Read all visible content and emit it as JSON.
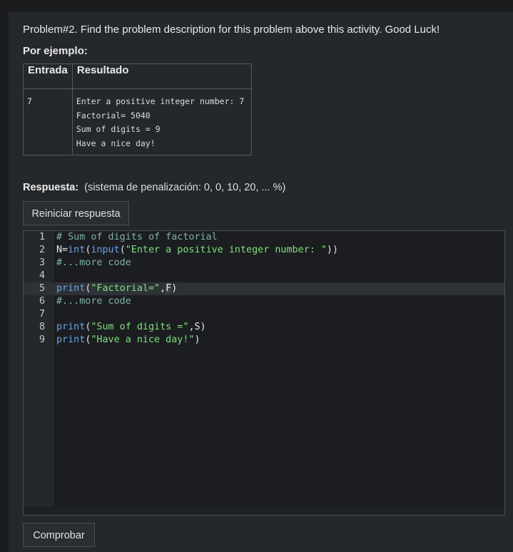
{
  "problem": {
    "title": "Problem#2.  Find the problem description for this problem above this activity.  Good Luck!",
    "example_label": "Por ejemplo:"
  },
  "example_table": {
    "headers": [
      "Entrada",
      "Resultado"
    ],
    "input": "7",
    "output_lines": [
      "Enter a positive integer number: 7",
      "Factorial= 5040",
      "Sum of digits = 9",
      "Have a nice day!"
    ]
  },
  "answer": {
    "label": "Respuesta:",
    "penalty": "(sistema de penalización: 0, 0, 10, 20, ... %)",
    "reset_button": "Reiniciar respuesta",
    "check_button": "Comprobar"
  },
  "editor": {
    "active_line": 5,
    "lines": [
      {
        "n": "1",
        "tokens": [
          {
            "t": "# Sum of digits of factorial",
            "c": "comment"
          }
        ]
      },
      {
        "n": "2",
        "tokens": [
          {
            "t": "N=",
            "c": "plain"
          },
          {
            "t": "int",
            "c": "kw"
          },
          {
            "t": "(",
            "c": "plain"
          },
          {
            "t": "input",
            "c": "kw"
          },
          {
            "t": "(",
            "c": "plain"
          },
          {
            "t": "\"Enter a positive integer number: \"",
            "c": "str"
          },
          {
            "t": "))",
            "c": "plain"
          }
        ]
      },
      {
        "n": "3",
        "tokens": [
          {
            "t": "#...more code",
            "c": "comment"
          }
        ]
      },
      {
        "n": "4",
        "tokens": []
      },
      {
        "n": "5",
        "tokens": [
          {
            "t": "print",
            "c": "kw"
          },
          {
            "t": "(",
            "c": "plain"
          },
          {
            "t": "\"Factorial=\"",
            "c": "str"
          },
          {
            "t": ",",
            "c": "plain"
          },
          {
            "t": "F",
            "c": "sel"
          },
          {
            "t": ")",
            "c": "plain"
          }
        ]
      },
      {
        "n": "6",
        "tokens": [
          {
            "t": "#...more code",
            "c": "comment"
          }
        ]
      },
      {
        "n": "7",
        "tokens": []
      },
      {
        "n": "8",
        "tokens": [
          {
            "t": "print",
            "c": "kw"
          },
          {
            "t": "(",
            "c": "plain"
          },
          {
            "t": "\"Sum of digits =\"",
            "c": "str"
          },
          {
            "t": ",S)",
            "c": "plain"
          }
        ]
      },
      {
        "n": "9",
        "tokens": [
          {
            "t": "print",
            "c": "kw"
          },
          {
            "t": "(",
            "c": "plain"
          },
          {
            "t": "\"Have a nice day!\"",
            "c": "str"
          },
          {
            "t": ")",
            "c": "plain"
          }
        ]
      }
    ]
  },
  "colors": {
    "comment": "#7fb3a8",
    "keyword": "#6aa3e6",
    "string": "#7ee07e"
  }
}
